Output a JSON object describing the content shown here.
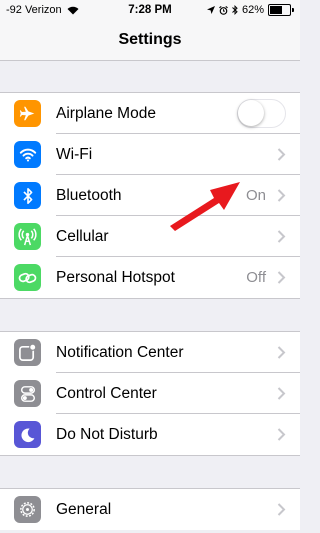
{
  "status_bar": {
    "carrier": "-92 Verizon",
    "time": "7:28 PM",
    "battery": "62%",
    "battery_level": 0.62,
    "icons": [
      "wifi-icon",
      "location-icon",
      "alarm-icon",
      "bluetooth-icon",
      "battery-icon"
    ]
  },
  "nav": {
    "title": "Settings"
  },
  "groups": [
    {
      "rows": [
        {
          "label": "Airplane Mode",
          "icon": "airplane-icon",
          "color": "#ff9500",
          "control": "toggle",
          "toggle_on": false
        },
        {
          "label": "Wi-Fi",
          "icon": "wifi-icon",
          "color": "#007aff",
          "detail": ""
        },
        {
          "label": "Bluetooth",
          "icon": "bluetooth-icon",
          "color": "#007aff",
          "detail": "On"
        },
        {
          "label": "Cellular",
          "icon": "antenna-icon",
          "color": "#4cd964",
          "detail": ""
        },
        {
          "label": "Personal Hotspot",
          "icon": "hotspot-icon",
          "color": "#4cd964",
          "detail": "Off"
        }
      ]
    },
    {
      "rows": [
        {
          "label": "Notification Center",
          "icon": "notification-center-icon",
          "color": "#8e8e93"
        },
        {
          "label": "Control Center",
          "icon": "control-center-icon",
          "color": "#8e8e93"
        },
        {
          "label": "Do Not Disturb",
          "icon": "moon-icon",
          "color": "#5856d6"
        }
      ]
    },
    {
      "rows": [
        {
          "label": "General",
          "icon": "gear-icon",
          "color": "#8e8e93"
        }
      ]
    }
  ],
  "annotation": {
    "arrow_color": "#e8191e",
    "points_to": "bluetooth-detail"
  }
}
